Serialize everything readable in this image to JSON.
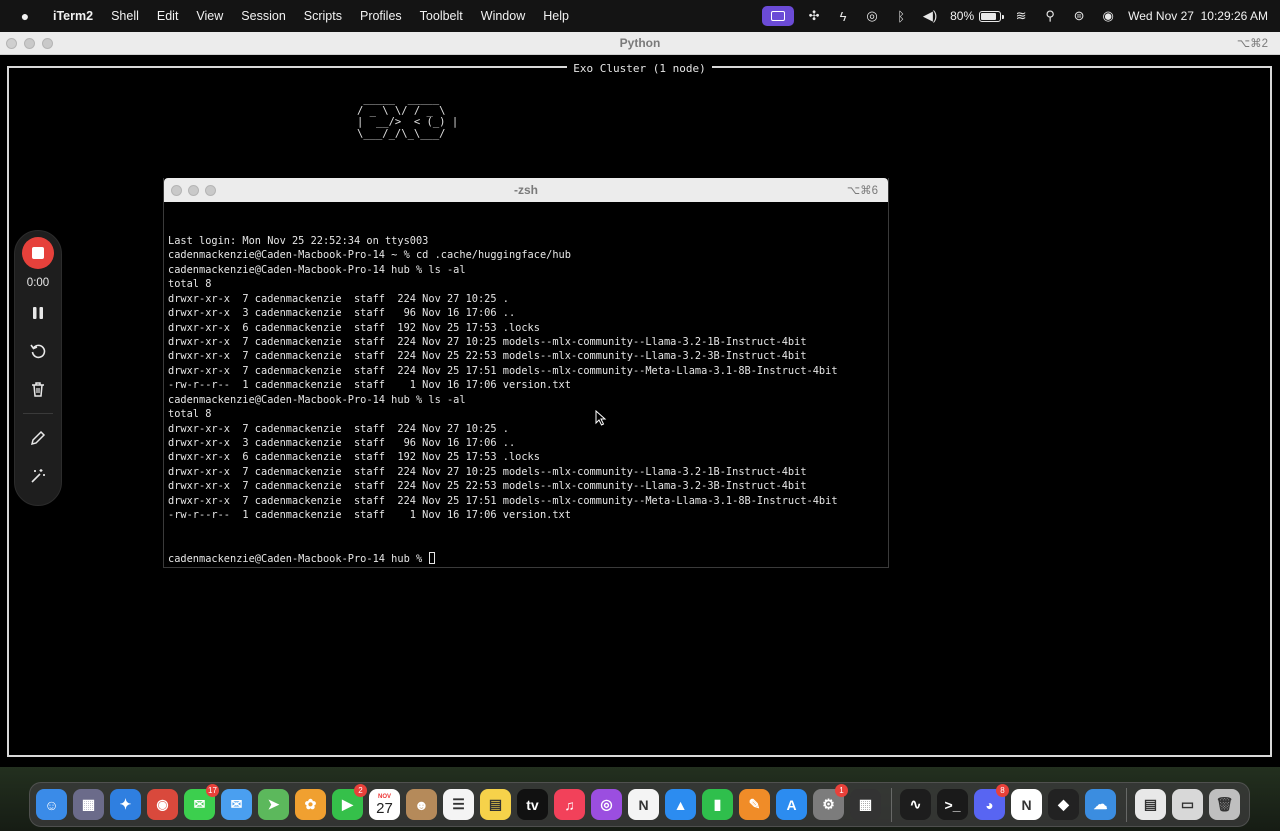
{
  "menubar": {
    "app_name": "iTerm2",
    "items": [
      "Shell",
      "Edit",
      "View",
      "Session",
      "Scripts",
      "Profiles",
      "Toolbelt",
      "Window",
      "Help"
    ],
    "battery_percent": "80%",
    "datetime": "Wed Nov 27  10:29:26 AM",
    "battery_level": 0.8
  },
  "outer_window": {
    "title": "Python",
    "shortcut": "⌥⌘2",
    "tui_title": "Exo Cluster (1 node)",
    "ascii_logo": " _____  _____\n/ _ \\ \\/ / _ \\\n|  __/>  < (_) |\n\\___/_/\\_\\___/"
  },
  "zsh_window": {
    "title": "-zsh",
    "shortcut": "⌥⌘6",
    "lines": [
      "Last login: Mon Nov 25 22:52:34 on ttys003",
      "cadenmackenzie@Caden-Macbook-Pro-14 ~ % cd .cache/huggingface/hub",
      "cadenmackenzie@Caden-Macbook-Pro-14 hub % ls -al",
      "total 8",
      "drwxr-xr-x  7 cadenmackenzie  staff  224 Nov 27 10:25 .",
      "drwxr-xr-x  3 cadenmackenzie  staff   96 Nov 16 17:06 ..",
      "drwxr-xr-x  6 cadenmackenzie  staff  192 Nov 25 17:53 .locks",
      "drwxr-xr-x  7 cadenmackenzie  staff  224 Nov 27 10:25 models--mlx-community--Llama-3.2-1B-Instruct-4bit",
      "drwxr-xr-x  7 cadenmackenzie  staff  224 Nov 25 22:53 models--mlx-community--Llama-3.2-3B-Instruct-4bit",
      "drwxr-xr-x  7 cadenmackenzie  staff  224 Nov 25 17:51 models--mlx-community--Meta-Llama-3.1-8B-Instruct-4bit",
      "-rw-r--r--  1 cadenmackenzie  staff    1 Nov 16 17:06 version.txt",
      "cadenmackenzie@Caden-Macbook-Pro-14 hub % ls -al",
      "total 8",
      "drwxr-xr-x  7 cadenmackenzie  staff  224 Nov 27 10:25 .",
      "drwxr-xr-x  3 cadenmackenzie  staff   96 Nov 16 17:06 ..",
      "drwxr-xr-x  6 cadenmackenzie  staff  192 Nov 25 17:53 .locks",
      "drwxr-xr-x  7 cadenmackenzie  staff  224 Nov 27 10:25 models--mlx-community--Llama-3.2-1B-Instruct-4bit",
      "drwxr-xr-x  7 cadenmackenzie  staff  224 Nov 25 22:53 models--mlx-community--Llama-3.2-3B-Instruct-4bit",
      "drwxr-xr-x  7 cadenmackenzie  staff  224 Nov 25 17:51 models--mlx-community--Meta-Llama-3.1-8B-Instruct-4bit",
      "-rw-r--r--  1 cadenmackenzie  staff    1 Nov 16 17:06 version.txt"
    ],
    "prompt": "cadenmackenzie@Caden-Macbook-Pro-14 hub % "
  },
  "recorder": {
    "timer": "0:00",
    "stop_color": "#e6413b"
  },
  "dock": {
    "apps": [
      {
        "name": "finder",
        "color": "#3a8be8",
        "glyph": "☺"
      },
      {
        "name": "launchpad",
        "color": "#6b6b8a",
        "glyph": "▦"
      },
      {
        "name": "safari",
        "color": "#2f7fe0",
        "glyph": "✦"
      },
      {
        "name": "chrome",
        "color": "#d9493c",
        "glyph": "◉"
      },
      {
        "name": "messages",
        "color": "#3ccf4e",
        "glyph": "✉",
        "badge": "17"
      },
      {
        "name": "mail",
        "color": "#4a9ff0",
        "glyph": "✉"
      },
      {
        "name": "maps",
        "color": "#5cb85c",
        "glyph": "➤"
      },
      {
        "name": "photos",
        "color": "#f0a030",
        "glyph": "✿"
      },
      {
        "name": "facetime",
        "color": "#35c04a",
        "glyph": "▶",
        "badge": "2"
      },
      {
        "name": "calendar",
        "color": "#ffffff",
        "glyph": "",
        "month": "NOV",
        "day": "27"
      },
      {
        "name": "contacts",
        "color": "#b58a5a",
        "glyph": "☻"
      },
      {
        "name": "reminders",
        "color": "#f4f4f4",
        "glyph": "☰"
      },
      {
        "name": "notes",
        "color": "#f6d24a",
        "glyph": "▤"
      },
      {
        "name": "apple-tv",
        "color": "#111111",
        "glyph": "tv"
      },
      {
        "name": "music",
        "color": "#f2415a",
        "glyph": "♫"
      },
      {
        "name": "podcasts",
        "color": "#9b4ee0",
        "glyph": "◎"
      },
      {
        "name": "news",
        "color": "#f4f4f4",
        "glyph": "N"
      },
      {
        "name": "keynote",
        "color": "#2c8cf0",
        "glyph": "▲"
      },
      {
        "name": "numbers",
        "color": "#2fbf4c",
        "glyph": "▮"
      },
      {
        "name": "pages",
        "color": "#f08c28",
        "glyph": "✎"
      },
      {
        "name": "app-store",
        "color": "#2c8cf0",
        "glyph": "A"
      },
      {
        "name": "system-settings",
        "color": "#7c7c7c",
        "glyph": "⚙",
        "badge": "1"
      },
      {
        "name": "calculator",
        "color": "#333333",
        "glyph": "▦"
      }
    ],
    "apps_right": [
      {
        "name": "activity-monitor",
        "color": "#1d1d1d",
        "glyph": "∿"
      },
      {
        "name": "terminal",
        "color": "#1a1a1a",
        "glyph": ">_"
      },
      {
        "name": "discord",
        "color": "#5865f2",
        "glyph": "◕",
        "badge": "8"
      },
      {
        "name": "notion",
        "color": "#ffffff",
        "glyph": "N"
      },
      {
        "name": "iterm-cube",
        "color": "#222222",
        "glyph": "◆"
      },
      {
        "name": "weather",
        "color": "#3b8de0",
        "glyph": "☁"
      }
    ],
    "apps_trailing": [
      {
        "name": "document-stack",
        "color": "#e8e8e8",
        "glyph": "▤"
      },
      {
        "name": "folder-stack",
        "color": "#d8d8d8",
        "glyph": "▭"
      },
      {
        "name": "trash",
        "color": "#bfbfbf",
        "glyph": "🗑"
      }
    ]
  }
}
